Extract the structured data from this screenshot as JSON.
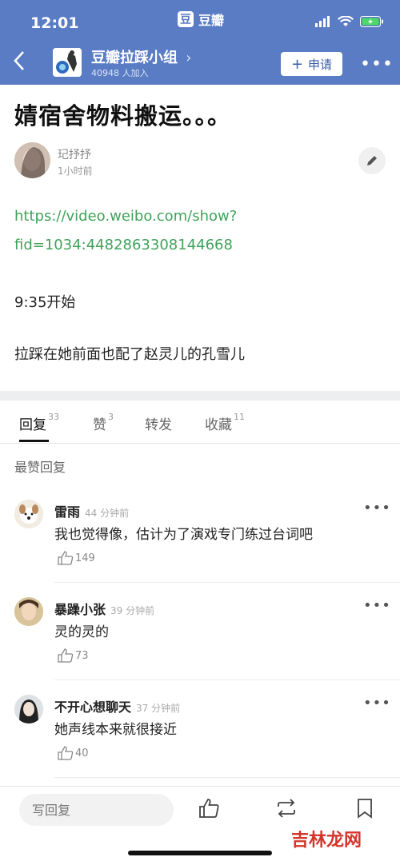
{
  "status": {
    "time": "12:01",
    "app_name": "豆瓣",
    "app_logo_char": "豆"
  },
  "nav": {
    "group_name": "豆瓣拉踩小组",
    "group_chevron": "›",
    "member_count": "40948 人加入",
    "join_label": "申请",
    "join_plus": "+",
    "more": "•••"
  },
  "post": {
    "title": "婧宿舍物料搬运。。。",
    "author": "玘抒抒",
    "time": "1小时前",
    "link_line1": "https://video.weibo.com/show?",
    "link_line2": "fid=1034:4482863308144668",
    "para1": "9:35开始",
    "para2": "拉踩在她前面也配了赵灵儿的孔雪儿"
  },
  "tabs": [
    {
      "label": "回复",
      "count": "33"
    },
    {
      "label": "赞",
      "count": "3"
    },
    {
      "label": "转发",
      "count": ""
    },
    {
      "label": "收藏",
      "count": "11"
    }
  ],
  "section_title": "最赞回复",
  "comments": [
    {
      "name": "雷雨",
      "time": "44 分钟前",
      "text": "我也觉得像，估计为了演戏专门练过台词吧",
      "likes": "149",
      "more": "•••"
    },
    {
      "name": "暴躁小张",
      "time": "39 分钟前",
      "text": "灵的灵的",
      "likes": "73",
      "more": "•••"
    },
    {
      "name": "不开心想聊天",
      "time": "37 分钟前",
      "text": "她声线本来就很接近",
      "likes": "40",
      "more": "•••"
    }
  ],
  "bottom": {
    "reply_placeholder": "写回复"
  },
  "watermark": "吉林龙网",
  "colors": {
    "header": "#5a7cc4",
    "link": "#3fa25a",
    "watermark": "#d4352a"
  }
}
